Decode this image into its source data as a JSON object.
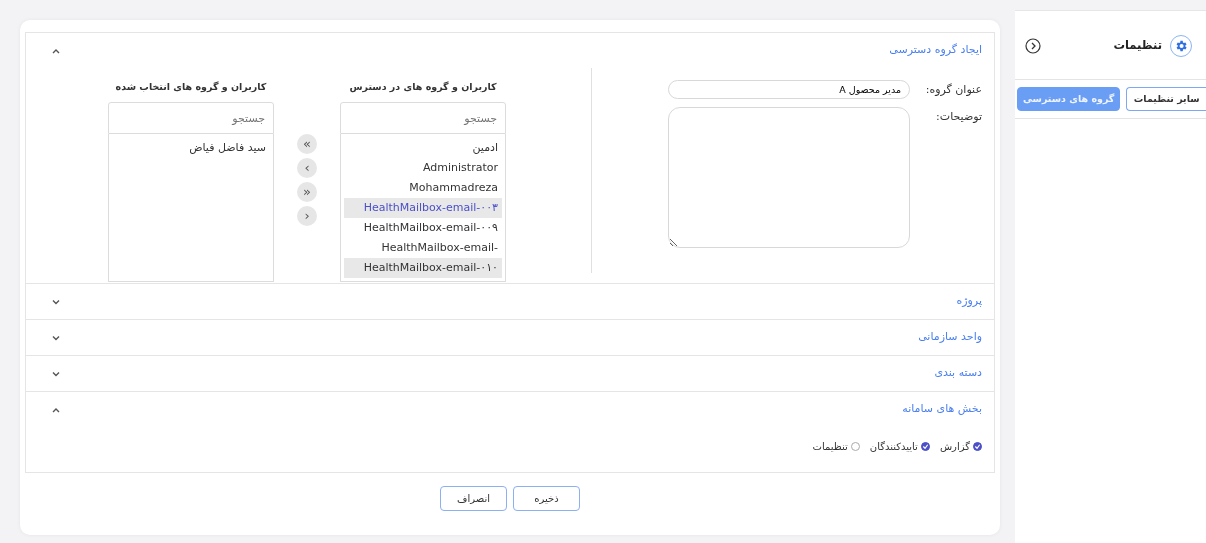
{
  "sidebar": {
    "title": "تنظیمات",
    "tabs": [
      {
        "label": "سایر تنظیمات",
        "selected": false
      },
      {
        "label": "گروه های دسترسی",
        "selected": true
      }
    ]
  },
  "sections": [
    {
      "title": "ایجاد گروه دسترسی",
      "expanded": true,
      "kind": "group-form",
      "form": {
        "title_label": "عنوان گروه:",
        "title_value": "مدیر محصول A",
        "description_label": "توضیحات:",
        "available": {
          "heading": "کاربران و گروه های در دسترس",
          "search_placeholder": "جستجو",
          "items": [
            {
              "label": "ادمین",
              "selected": false,
              "highlighted": false
            },
            {
              "label": "Administrator",
              "selected": false,
              "highlighted": false
            },
            {
              "label": "Mohammadreza",
              "selected": false,
              "highlighted": false
            },
            {
              "label": "HealthMailbox-email-۰۰۳",
              "selected": true,
              "highlighted": true
            },
            {
              "label": "HealthMailbox-email-۰۰۹",
              "selected": false,
              "highlighted": false
            },
            {
              "label": "HealthMailbox-email-",
              "selected": false,
              "highlighted": false
            },
            {
              "label": "HealthMailbox-email-۰۱۰",
              "selected": true,
              "highlighted": false
            }
          ]
        },
        "transfer_buttons": [
          "«",
          "‹",
          "»",
          "›"
        ],
        "chosen": {
          "heading": "کاربران و گروه های انتخاب شده",
          "search_placeholder": "جستجو",
          "items": [
            {
              "label": "سید فاضل فیاض",
              "selected": false,
              "highlighted": false
            }
          ]
        }
      }
    },
    {
      "title": "پروژه",
      "expanded": false
    },
    {
      "title": "واحد سازمانی",
      "expanded": false
    },
    {
      "title": "دسته بندی",
      "expanded": false
    },
    {
      "title": "بخش های سامانه",
      "expanded": true,
      "kind": "checkboxes",
      "options": [
        {
          "label": "گزارش",
          "checked": true
        },
        {
          "label": "تاییدکنندگان",
          "checked": true
        },
        {
          "label": "تنظیمات",
          "checked": false
        }
      ]
    }
  ],
  "buttons": [
    "ذخیره",
    "انصراف"
  ]
}
